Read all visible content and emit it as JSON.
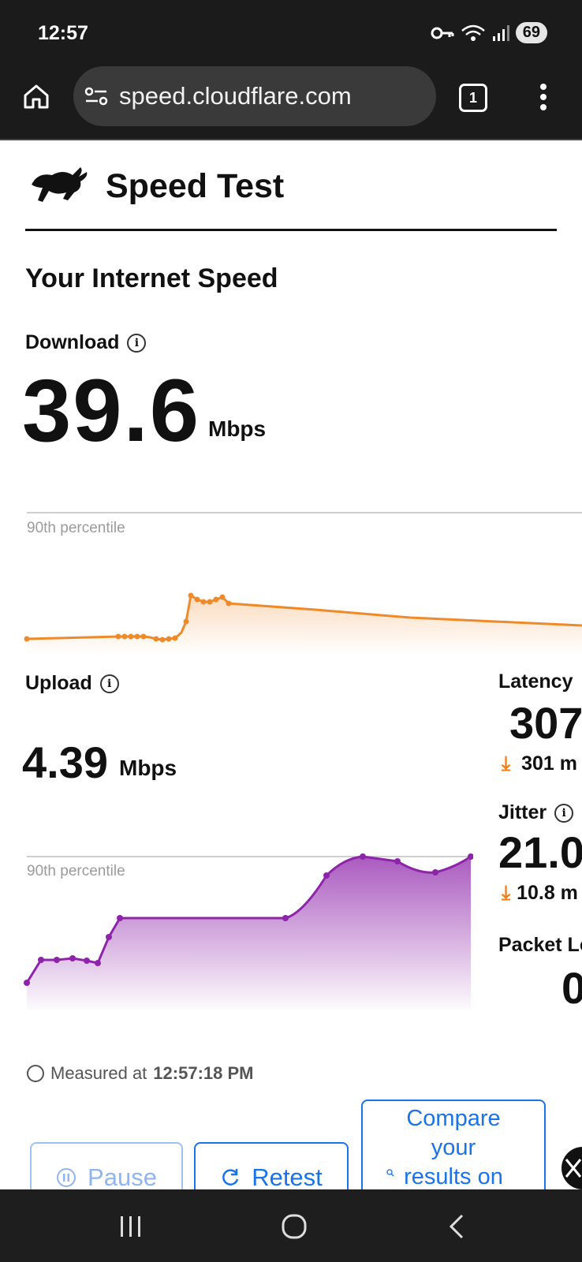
{
  "status_bar": {
    "time": "12:57",
    "battery": "69"
  },
  "browser": {
    "url": "speed.cloudflare.com",
    "tab_count": "1"
  },
  "header": {
    "title": "Speed Test"
  },
  "section_title": "Your Internet Speed",
  "download": {
    "label": "Download",
    "value": "39.6",
    "unit": "Mbps",
    "percentile_label": "90th percentile"
  },
  "upload": {
    "label": "Upload",
    "value": "4.39",
    "unit": "Mbps",
    "percentile_label": "90th percentile"
  },
  "latency": {
    "label": "Latency",
    "value": "307",
    "loaded": "301 m"
  },
  "jitter": {
    "label": "Jitter",
    "value": "21.0",
    "loaded": "10.8 m"
  },
  "packet_loss": {
    "label": "Packet Lo",
    "value": "0"
  },
  "measured": {
    "prefix": "Measured at",
    "time": "12:57:18 PM"
  },
  "buttons": {
    "pause": "Pause",
    "retest": "Retest",
    "compare_lines": [
      "Compare",
      "your",
      "results on"
    ]
  },
  "colors": {
    "download": "#ef8a2b",
    "upload": "#8e24aa",
    "accent": "#1a73e8"
  }
}
